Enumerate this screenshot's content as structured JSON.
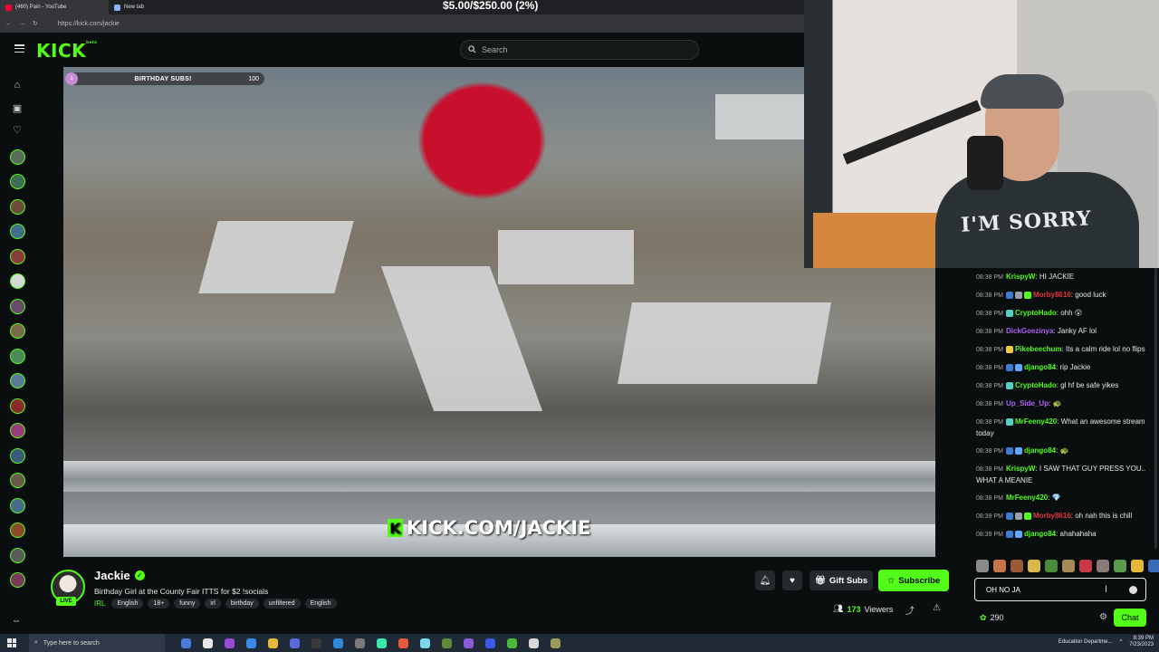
{
  "browser": {
    "tabs": [
      {
        "label": "(460) Pain - YouTube",
        "color": "#ff0033"
      },
      {
        "label": "New tab",
        "color": "#8ab4f8"
      }
    ],
    "url": "https://kick.com/jackie",
    "goal_overlay_text": "$5.00/$250.00 (2%)"
  },
  "header": {
    "logo_text": "KICK",
    "logo_tag": "beta",
    "search_placeholder": "Search"
  },
  "video": {
    "sub_goal": {
      "label": "BIRTHDAY SUBS!",
      "current": "1",
      "target": "100"
    },
    "watermark_text": "KICK.COM/JACKIE"
  },
  "webcam": {
    "shirt_text": "I'M SORRY"
  },
  "stream": {
    "channel_name": "Jackie",
    "live_label": "LIVE",
    "title": "Birthday Girl at the County Fair  ITTS for $2 !socials",
    "category": "IRL",
    "tags": [
      "English",
      "18+",
      "funny",
      "irl",
      "birthday",
      "unfiltered",
      "English"
    ],
    "gift_label": "Gift Subs",
    "subscribe_label": "Subscribe",
    "viewer_count": "173",
    "viewers_label": "Viewers"
  },
  "chat": {
    "messages": [
      {
        "time": "08:38 PM",
        "user": "KrispyW",
        "color": "#53fc18",
        "badges": [],
        "text": "HI JACKIE"
      },
      {
        "time": "08:38 PM",
        "user": "Morby8616",
        "color": "#e3343c",
        "badges": [
          "#3a7bd5",
          "#9aa0a6",
          "#53fc18"
        ],
        "text": "good luck"
      },
      {
        "time": "08:38 PM",
        "user": "CryptoHado",
        "color": "#53fc18",
        "badges": [
          "#4fd1c5"
        ],
        "text": "ohh 😮"
      },
      {
        "time": "08:38 PM",
        "user": "DickGoezinya",
        "color": "#ad5ff3",
        "badges": [],
        "text": "Janky AF lol"
      },
      {
        "time": "08:38 PM",
        "user": "Pikebeechum",
        "color": "#53fc18",
        "badges": [
          "#f6c945"
        ],
        "text": "Its a calm ride lol no flips"
      },
      {
        "time": "08:38 PM",
        "user": "django84",
        "color": "#53fc18",
        "badges": [
          "#3a7bd5",
          "#5fa8ff"
        ],
        "text": "rip Jackie"
      },
      {
        "time": "08:38 PM",
        "user": "CryptoHado",
        "color": "#53fc18",
        "badges": [
          "#4fd1c5"
        ],
        "text": "gl hf be safe yikes"
      },
      {
        "time": "08:38 PM",
        "user": "Up_Side_Up",
        "color": "#ad5ff3",
        "badges": [],
        "text": "🐢"
      },
      {
        "time": "08:38 PM",
        "user": "MrFeeny420",
        "color": "#53fc18",
        "badges": [
          "#4fd1c5"
        ],
        "text": "What an awesome stream today"
      },
      {
        "time": "08:38 PM",
        "user": "django84",
        "color": "#53fc18",
        "badges": [
          "#3a7bd5",
          "#5fa8ff"
        ],
        "text": "🐢"
      },
      {
        "time": "08:38 PM",
        "user": "KrispyW",
        "color": "#53fc18",
        "badges": [],
        "text": "I SAW THAT GUY PRESS YOU.. WHAT A MEANIE"
      },
      {
        "time": "08:38 PM",
        "user": "MrFeeny420",
        "color": "#53fc18",
        "badges": [],
        "text": "💎"
      },
      {
        "time": "08:39 PM",
        "user": "Morby8616",
        "color": "#e3343c",
        "badges": [
          "#3a7bd5",
          "#9aa0a6",
          "#53fc18"
        ],
        "text": "oh nah this is chill"
      },
      {
        "time": "08:39 PM",
        "user": "django84",
        "color": "#53fc18",
        "badges": [
          "#3a7bd5",
          "#5fa8ff"
        ],
        "text": "ahahahaha"
      }
    ],
    "input_value": "OH NO JA",
    "points": "290",
    "chat_button_label": "Chat"
  },
  "taskbar": {
    "search_placeholder": "Type here to search",
    "tray_text": "Education Departme...",
    "time": "8:39 PM",
    "date": "7/23/2023"
  }
}
